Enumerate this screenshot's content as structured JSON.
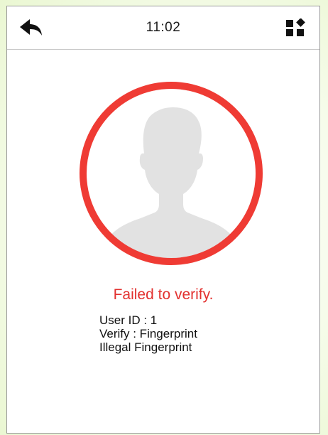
{
  "header": {
    "time": "11:02",
    "back_icon": "back-arrow-icon",
    "menu_icon": "grid-menu-icon"
  },
  "verification": {
    "status": "Failed to verify.",
    "user_id_line": "User ID : 1",
    "verify_line": "Verify : Fingerprint",
    "detail_line": "Illegal Fingerprint"
  },
  "colors": {
    "ring": "#ef3b34",
    "status_text": "#e2312f",
    "silhouette": "#e2e2e2"
  }
}
